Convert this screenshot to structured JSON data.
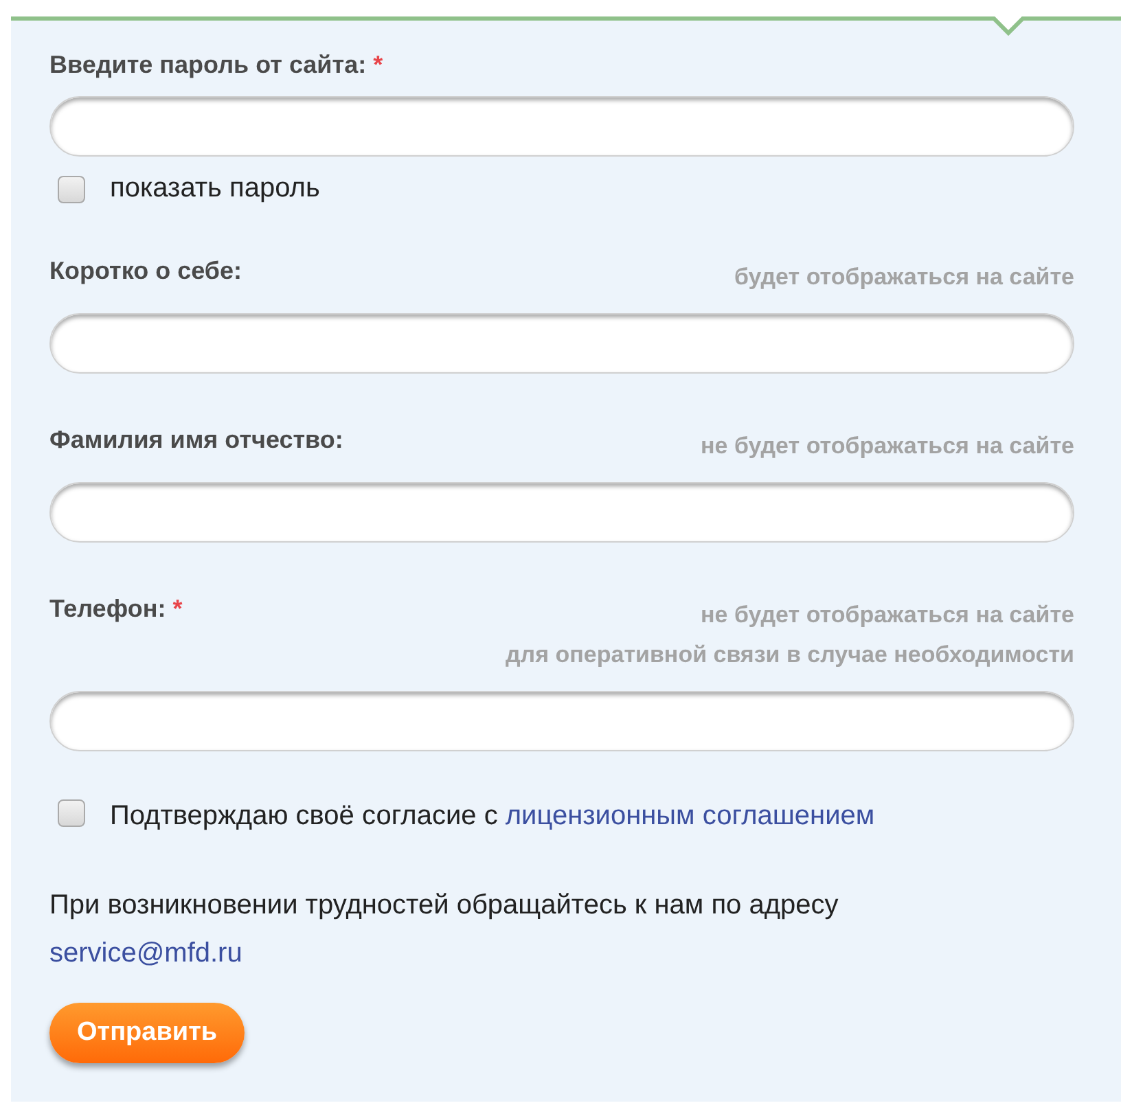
{
  "fields": [
    {
      "label": "Введите пароль от сайта:",
      "required": true,
      "toggle": {
        "label": "показать пароль",
        "checked": false
      }
    },
    {
      "label": "Коротко о себе:",
      "required": false,
      "hints": [
        "будет отображаться на сайте"
      ]
    },
    {
      "label": "Фамилия имя отчество:",
      "required": false,
      "hints": [
        "не будет отображаться на сайте"
      ]
    },
    {
      "label": "Телефон:",
      "required": true,
      "hints": [
        "не будет отображаться на сайте",
        "для оперативной связи в случае необходимости"
      ]
    }
  ],
  "required_mark": "*",
  "consent": {
    "text": "Подтверждаю своё согласие с",
    "link": "лицензионным соглашением",
    "checked": false
  },
  "contact": {
    "text": "При возникновении трудностей обращайтесь к нам по адресу",
    "email": "service@mfd.ru"
  },
  "submit": "Отправить"
}
